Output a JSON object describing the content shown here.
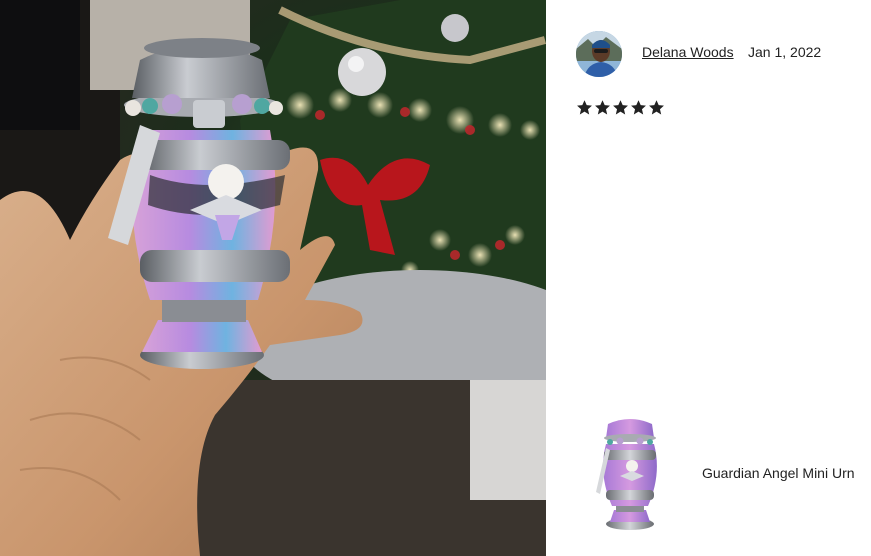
{
  "photo": {
    "alt_subject": "urn-in-hand"
  },
  "review": {
    "reviewer_name": "Delana Woods",
    "date": "Jan 1, 2022",
    "rating": 5,
    "rating_max": 5
  },
  "product": {
    "name": "Guardian Angel Mini Urn"
  },
  "icons": {
    "star": "star-icon",
    "avatar": "avatar"
  },
  "colors": {
    "star": "#222222",
    "text": "#222222"
  }
}
